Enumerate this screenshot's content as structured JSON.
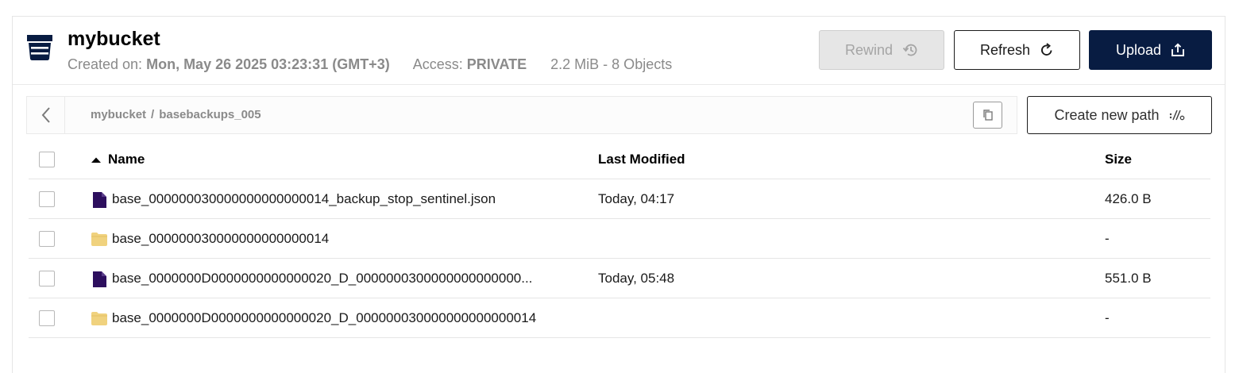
{
  "bucket": {
    "name": "mybucket",
    "created_label": "Created on:",
    "created_value": "Mon, May 26 2025 03:23:31 (GMT+3)",
    "access_label": "Access:",
    "access_value": "PRIVATE",
    "usage": "2.2 MiB - 8 Objects"
  },
  "toolbar": {
    "rewind_label": "Rewind",
    "refresh_label": "Refresh",
    "upload_label": "Upload",
    "create_path_label": "Create new path"
  },
  "breadcrumb": {
    "items": [
      "mybucket",
      "basebackups_005"
    ],
    "separator": "/"
  },
  "table": {
    "columns": [
      "Name",
      "Last Modified",
      "Size"
    ],
    "sort_column": "Name",
    "sort_direction": "ascending",
    "rows": [
      {
        "type": "file",
        "name": "base_000000030000000000000014_backup_stop_sentinel.json",
        "modified": "Today, 04:17",
        "size": "426.0 B"
      },
      {
        "type": "folder",
        "name": "base_000000030000000000000014",
        "modified": "",
        "size": "-"
      },
      {
        "type": "file",
        "name": "base_0000000D0000000000000020_D_0000000300000000000000...",
        "modified": "Today, 05:48",
        "size": "551.0 B"
      },
      {
        "type": "folder",
        "name": "base_0000000D0000000000000020_D_000000030000000000000014",
        "modified": "",
        "size": "-"
      }
    ]
  },
  "icons": {
    "bucket": "bucket-icon",
    "rewind": "history-icon",
    "refresh": "refresh-icon",
    "upload": "upload-icon",
    "back": "chevron-left-icon",
    "copy": "copy-icon",
    "new_path": "new-path-icon",
    "file": "file-icon",
    "folder": "folder-icon"
  },
  "colors": {
    "primary": "#081c42",
    "file_icon": "#2d0f5e",
    "folder_icon": "#f0d27e",
    "muted_text": "#8a8a8a",
    "disabled_bg": "#e6e6e6"
  }
}
